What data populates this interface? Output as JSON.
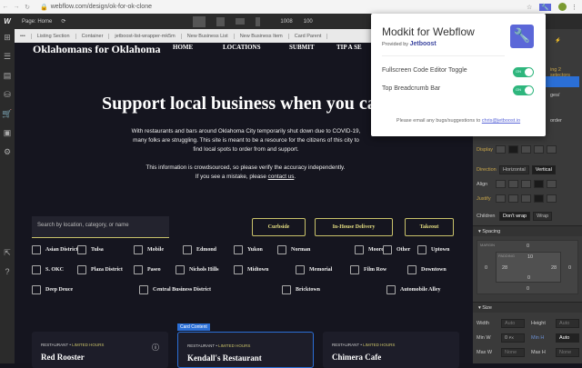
{
  "browser": {
    "url": "webflow.com/design/ok-for-ok-clone"
  },
  "designer": {
    "page_label": "Page: Home",
    "width": "1008",
    "zoom": "100",
    "breadcrumbs": [
      "•••",
      "Listing Section",
      "Container",
      "jetboost-list-wrapper-mk5m",
      "New Business List",
      "New Business Item",
      "Card Parent"
    ]
  },
  "site": {
    "brand": "Oklahomans for Oklahoma",
    "nav": [
      "HOME",
      "LOCATIONS",
      "SUBMIT",
      "TIP A SE"
    ],
    "hero_title": "Support local business when you ca",
    "intro": "With restaurants and bars around Oklahoma City temporarily shut down due to COVID-19, many folks are struggling. This site is meant to be a resource for the citizens of this city to find local spots to order from and support.",
    "note": "This information is crowdsourced, so please verify the accuracy independently. If you see a mistake, please",
    "note_link": "contact us",
    "note_end": ".",
    "search_placeholder": "Search by location, category, or name",
    "filters": [
      "Curbside",
      "In-House Delivery",
      "Takeout"
    ],
    "districts": [
      [
        "Asian District",
        "Tulsa",
        "Mobile",
        "Edmond",
        "Yukon",
        "Norman",
        "Moore",
        "Other",
        "Uptown"
      ],
      [
        "S. OKC",
        "Plaza District",
        "Paseo",
        "Nichols Hills",
        "Midtown",
        "Memorial",
        "Film Row",
        "Downtown"
      ],
      [
        "Deep Deuce",
        "Central Business District",
        "Bricktown",
        "Automobile Alley"
      ]
    ],
    "selection_label": "Card Content",
    "cards": [
      {
        "type": "RESTAURANT",
        "status": "LIMITED HOURS",
        "name": "Red Rooster"
      },
      {
        "type": "RESTAURANT",
        "status": "LIMITED HOURS",
        "name": "Kendall's Restaurant"
      },
      {
        "type": "RESTAURANT",
        "status": "LIMITED HOURS",
        "name": "Chimera Cafe"
      }
    ]
  },
  "popup": {
    "title": "Modkit for Webflow",
    "provided_by": "Provided by",
    "provider": "Jetboost",
    "options": [
      {
        "label": "Fullscreen Code Editor Toggle",
        "state": "ON"
      },
      {
        "label": "Top Breadcrumb Bar",
        "state": "ON"
      }
    ],
    "footer": "Please email any bugs/suggestions to",
    "email": "chris@jetboost.io"
  },
  "panel": {
    "selectors": "ing 2 selectors",
    "pages": "ges/",
    "border": "order",
    "display": "Display",
    "direction": "Direction",
    "horizontal": "Horizontal",
    "vertical": "Vertical",
    "align": "Align",
    "justify": "Justify",
    "children": "Children",
    "dont_wrap": "Don't wrap",
    "wrap": "Wrap",
    "spacing": "Spacing",
    "margin": "MARGIN",
    "padding": "PADDING",
    "m_top": "0",
    "m_left": "0",
    "m_right": "0",
    "m_bottom": "0",
    "p_top": "10",
    "p_left": "28",
    "p_right": "28",
    "p_bottom": "0",
    "size": "Size",
    "width": "Width",
    "height": "Height",
    "auto": "Auto",
    "min_w": "Min W",
    "min_w_val": "0",
    "px": "PX",
    "min_h": "Min H",
    "min_h_val": "Auto",
    "max_w": "Max W",
    "max_h": "Max H",
    "none": "None"
  },
  "colors": {
    "accent": "#c9c26a",
    "toggle": "#2fb67d",
    "jetboost": "#5b67d8"
  }
}
